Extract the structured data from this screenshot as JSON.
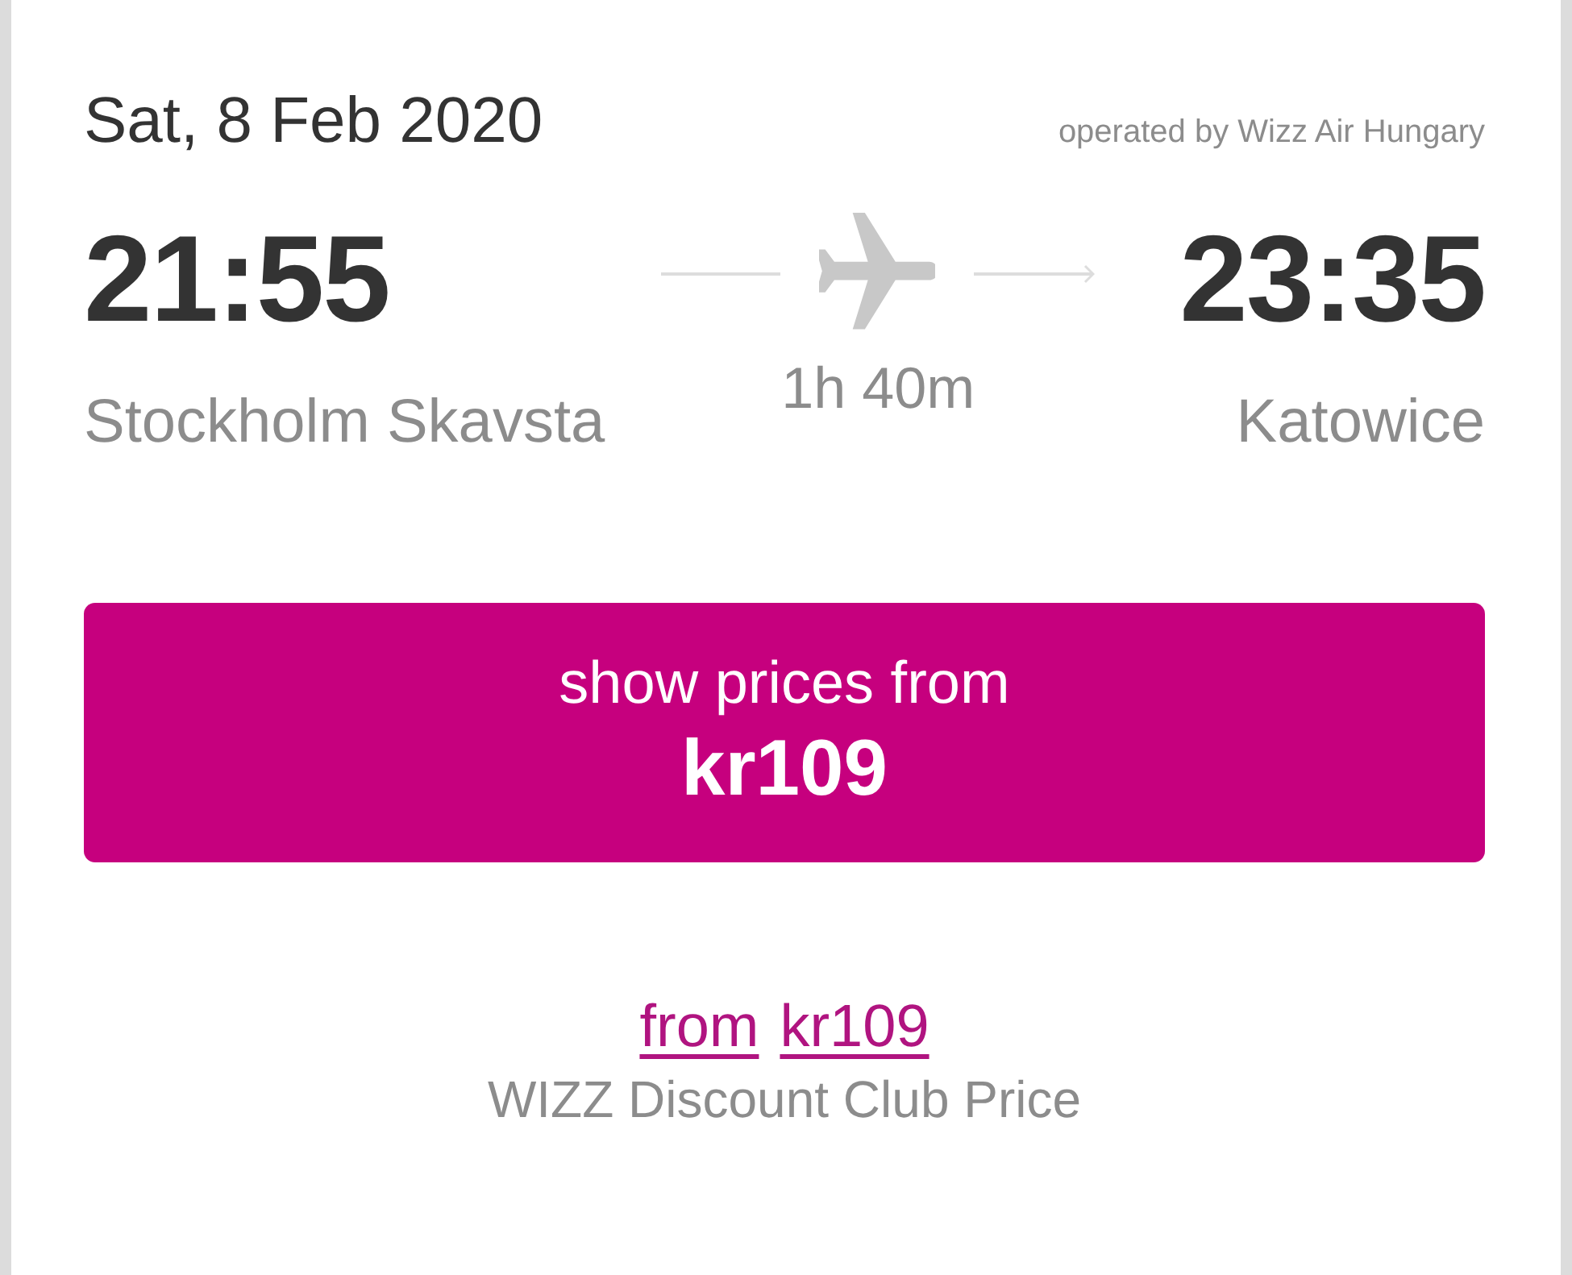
{
  "flight": {
    "date": "Sat, 8 Feb 2020",
    "operator": "operated by Wizz Air Hungary",
    "departure": {
      "time": "21:55",
      "airport": "Stockholm Skavsta"
    },
    "duration": "1h 40m",
    "arrival": {
      "time": "23:35",
      "airport": "Katowice"
    }
  },
  "price_button": {
    "label": "show prices from",
    "price": "kr109"
  },
  "club_price": {
    "links": [
      "from",
      "kr109"
    ],
    "caption": "WIZZ Discount Club Price"
  }
}
